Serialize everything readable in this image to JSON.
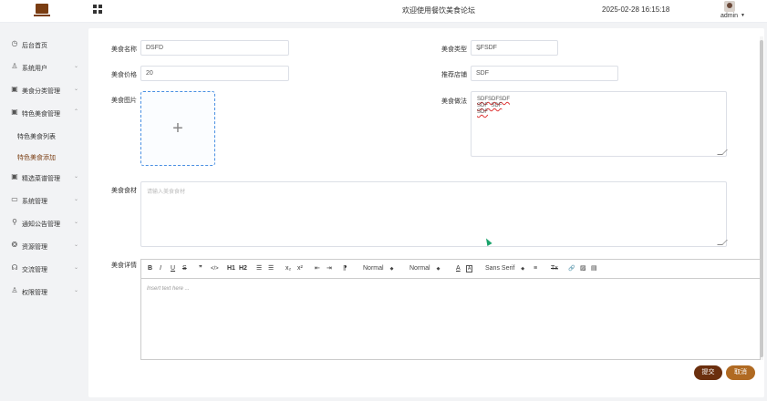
{
  "header": {
    "site_title": "欢迎使用餐饮美食论坛",
    "datetime": "2025-02-28 16:15:18",
    "user_name": "admin",
    "logo_icon": "monitor-logo-icon",
    "menu_toggle_icon": "grid-icon",
    "brand_color": "#7a3d12"
  },
  "sidebar": {
    "items": [
      {
        "label": "后台首页",
        "icon": "clock-icon",
        "glyph": "◷"
      },
      {
        "label": "系统用户",
        "icon": "user-icon",
        "glyph": "♙"
      },
      {
        "label": "美食分类管理",
        "icon": "folder-icon",
        "glyph": "▣"
      },
      {
        "label": "特色美食管理",
        "icon": "folder-icon",
        "glyph": "▣"
      },
      {
        "label": "精选菜谱管理",
        "icon": "folder-icon",
        "glyph": "▣"
      },
      {
        "label": "系统管理",
        "icon": "folder-icon",
        "glyph": "▭"
      },
      {
        "label": "通知公告管理",
        "icon": "search-icon",
        "glyph": "⚲"
      },
      {
        "label": "资源管理",
        "icon": "palette-icon",
        "glyph": "❂"
      },
      {
        "label": "交流管理",
        "icon": "headset-icon",
        "glyph": "☊"
      },
      {
        "label": "权限管理",
        "icon": "user-icon",
        "glyph": "♙"
      }
    ],
    "sub_items": [
      {
        "label": "特色美食列表"
      },
      {
        "label": "特色美食添加"
      }
    ]
  },
  "form": {
    "name_label": "美食名称",
    "name_value": "DSFD",
    "type_label": "美食类型",
    "type_value": "SFSDF",
    "price_label": "美食价格",
    "price_value": "20",
    "shop_label": "推荐店铺",
    "shop_value": "SDF",
    "image_label": "美食图片",
    "method_label": "美食做法",
    "method_line1": "SDFSDFSDF",
    "method_line2": "SDF  SDF",
    "method_line3": "SDF",
    "ingredients_label": "美食食材",
    "ingredients_placeholder": "请输入美食食材",
    "detail_label": "美食详情",
    "editor_placeholder": "Insert text here ..."
  },
  "editor_toolbar": {
    "bold": "B",
    "italic": "I",
    "underline": "U",
    "strike": "S",
    "quote": "❞",
    "code": "</>",
    "h1": "H1",
    "h2": "H2",
    "ordered_list": "☰",
    "bullet_list": "☰",
    "subscript": "x₂",
    "superscript": "x²",
    "outdent": "⇤",
    "indent": "⇥",
    "direction": "⁋",
    "size_value": "Normal",
    "header_value": "Normal",
    "color": "A",
    "background": "A",
    "font_value": "Sans Serif",
    "align": "≡",
    "clean": "Tx",
    "link": "🔗",
    "image": "▨",
    "video": "▤"
  },
  "actions": {
    "submit_label": "提交",
    "cancel_label": "取消",
    "submit_color": "#6b2f0e",
    "cancel_color": "#b06a22"
  }
}
